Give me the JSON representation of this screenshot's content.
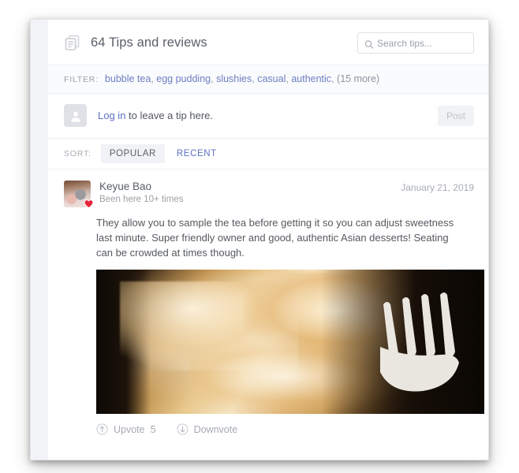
{
  "header": {
    "icon": "tips-list-icon",
    "title": "64 Tips and reviews",
    "search": {
      "icon": "search-icon",
      "placeholder": "Search tips...",
      "value": ""
    }
  },
  "filter": {
    "label": "FILTER:",
    "tags": [
      "bubble tea",
      "egg pudding",
      "slushies",
      "casual",
      "authentic"
    ],
    "more": "(15 more)",
    "separator": ","
  },
  "tip_entry": {
    "avatar_icon": "user-silhouette-icon",
    "login_label": "Log in",
    "prompt_text": " to leave a tip here.",
    "post_label": "Post"
  },
  "sort": {
    "label": "SORT:",
    "tabs": [
      {
        "label": "POPULAR",
        "active": true
      },
      {
        "label": "RECENT",
        "active": false
      }
    ]
  },
  "tip": {
    "avatar_badge_icon": "heart-icon",
    "username": "Keyue Bao",
    "checkins": "Been here 10+ times",
    "date": "January 21, 2019",
    "text": "They allow you to sample the tea before getting it so you can adjust sweetness last minute. Super friendly owner and good, authentic Asian desserts! Seating can be crowded at times though.",
    "photo_alt": "Close-up photo of golden caramel dessert squares with a white plastic fork on a dark plate",
    "upvote": {
      "icon": "arrow-up-circle-icon",
      "label": "Upvote",
      "count": "5"
    },
    "downvote": {
      "icon": "arrow-down-circle-icon",
      "label": "Downvote"
    }
  },
  "colors": {
    "link": "#5c72c4",
    "filter_link": "#6c7ec4",
    "text": "#55595f",
    "muted": "#9aa0a6",
    "heart": "#e8243c",
    "card_bg": "#ffffff",
    "shell_bg": "#f2f3f7"
  }
}
